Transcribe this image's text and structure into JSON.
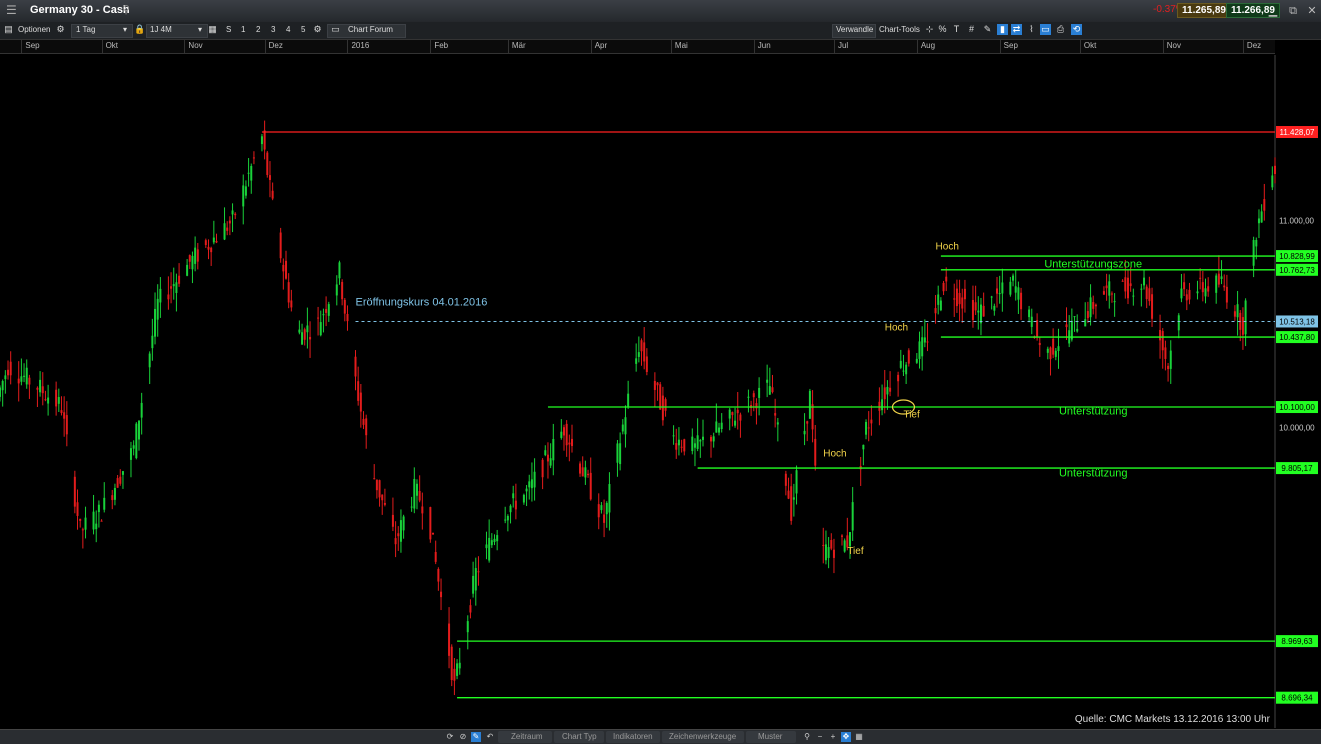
{
  "window": {
    "title": "Germany 30 - Cash",
    "change": "-0.37%",
    "sell_price": "11.265,89",
    "buy_price": "11.266,89"
  },
  "toolbar": {
    "options_label": "Optionen",
    "interval": "1 Tag",
    "range": "1J 4M",
    "period_buttons": [
      "S",
      "1",
      "2",
      "3",
      "4",
      "5"
    ],
    "chart_forum": "Chart Forum",
    "convert": "Verwandle",
    "chart_tools": "Chart-Tools"
  },
  "time_axis": {
    "labels": [
      "Sep",
      "Okt",
      "Nov",
      "Dez",
      "2016",
      "Feb",
      "Mär",
      "Apr",
      "Mai",
      "Jun",
      "Jul",
      "Aug",
      "Sep",
      "Okt",
      "Nov",
      "Dez"
    ]
  },
  "bottom_bar": {
    "items": [
      "Zeitraum",
      "Chart Typ",
      "Indikatoren",
      "Zeichenwerkzeuge",
      "Muster"
    ]
  },
  "source_text": "Quelle: CMC Markets 13.12.2016 13:00 Uhr",
  "colors": {
    "up": "#19d23a",
    "down": "#e41c1c",
    "support": "#22ff22",
    "resistance": "#ff2020",
    "note": "#f2d44a",
    "open_price": "#7fc3e6"
  },
  "chart_data": {
    "type": "candlestick",
    "instrument": "Germany 30 - Cash",
    "x_range": [
      "2015-08-24",
      "2016-12-13"
    ],
    "ylim": [
      8550,
      11800
    ],
    "y_ticks": [
      {
        "value": 11428.07,
        "label": "11.428,07",
        "kind": "resistance"
      },
      {
        "value": 11000,
        "label": "11.000,00",
        "kind": "tick"
      },
      {
        "value": 10828.99,
        "label": "10.828,99",
        "kind": "support"
      },
      {
        "value": 10762.73,
        "label": "10.762,73",
        "kind": "support"
      },
      {
        "value": 10513.18,
        "label": "10.513,18",
        "kind": "current"
      },
      {
        "value": 10437.8,
        "label": "10.437,80",
        "kind": "support"
      },
      {
        "value": 10100,
        "label": "10.100,00",
        "kind": "support"
      },
      {
        "value": 10000,
        "label": "10.000,00",
        "kind": "tick"
      },
      {
        "value": 9805.17,
        "label": "9.805,17",
        "kind": "support"
      },
      {
        "value": 8969.63,
        "label": "8.969,63",
        "kind": "support"
      },
      {
        "value": 8696.34,
        "label": "8.696,34",
        "kind": "support"
      }
    ],
    "lines": [
      {
        "value": 11428.07,
        "from": "2015-11-30",
        "color": "resistance"
      },
      {
        "value": 10828.99,
        "from": "2016-08-10",
        "color": "support"
      },
      {
        "value": 10762.73,
        "from": "2016-08-10",
        "color": "support"
      },
      {
        "value": 10513.18,
        "from": "2016-01-04",
        "color": "open_price",
        "dashed": true
      },
      {
        "value": 10437.8,
        "from": "2016-08-10",
        "color": "support"
      },
      {
        "value": 10100,
        "from": "2016-03-16",
        "color": "support"
      },
      {
        "value": 9805.17,
        "from": "2016-05-11",
        "color": "support"
      },
      {
        "value": 8969.63,
        "from": "2016-02-11",
        "color": "support"
      },
      {
        "value": 8696.34,
        "from": "2016-02-11",
        "color": "support"
      }
    ],
    "annotations": [
      {
        "text": "Eröffnungskurs 04.01.2016",
        "date": "2016-01-04",
        "value": 10590,
        "color": "open_price"
      },
      {
        "text": "Hoch",
        "date": "2016-08-08",
        "value": 10860,
        "color": "note"
      },
      {
        "text": "Hoch",
        "date": "2016-07-20",
        "value": 10470,
        "color": "note"
      },
      {
        "text": "Hoch",
        "date": "2016-06-27",
        "value": 9860,
        "color": "note"
      },
      {
        "text": "Tief",
        "date": "2016-07-06",
        "value": 9390,
        "color": "note"
      },
      {
        "text": "Tief",
        "date": "2016-07-27",
        "value": 10050,
        "color": "note"
      },
      {
        "text": "Unterstützungszone",
        "date": "2016-10-06",
        "value": 10775,
        "color": "support"
      },
      {
        "text": "Unterstützung",
        "date": "2016-10-06",
        "value": 10065,
        "color": "support"
      },
      {
        "text": "Unterstützung",
        "date": "2016-10-06",
        "value": 9765,
        "color": "support"
      }
    ],
    "price_anchors": [
      [
        "2015-08-24",
        10150
      ],
      [
        "2015-08-28",
        10300
      ],
      [
        "2015-09-08",
        10200
      ],
      [
        "2015-09-17",
        10100
      ],
      [
        "2015-09-24",
        9500
      ],
      [
        "2015-10-02",
        9600
      ],
      [
        "2015-10-14",
        9900
      ],
      [
        "2015-10-23",
        10600
      ],
      [
        "2015-11-04",
        10800
      ],
      [
        "2015-11-20",
        11000
      ],
      [
        "2015-12-01",
        11400
      ],
      [
        "2015-12-07",
        10900
      ],
      [
        "2015-12-14",
        10450
      ],
      [
        "2015-12-22",
        10500
      ],
      [
        "2015-12-30",
        10750
      ],
      [
        "2016-01-04",
        10300
      ],
      [
        "2016-01-11",
        9800
      ],
      [
        "2016-01-20",
        9450
      ],
      [
        "2016-01-27",
        9700
      ],
      [
        "2016-02-01",
        9600
      ],
      [
        "2016-02-11",
        8750
      ],
      [
        "2016-02-19",
        9300
      ],
      [
        "2016-03-01",
        9600
      ],
      [
        "2016-03-10",
        9700
      ],
      [
        "2016-03-23",
        10000
      ],
      [
        "2016-04-07",
        9550
      ],
      [
        "2016-04-20",
        10400
      ],
      [
        "2016-05-03",
        9950
      ],
      [
        "2016-05-11",
        9900
      ],
      [
        "2016-06-08",
        10200
      ],
      [
        "2016-06-16",
        9600
      ],
      [
        "2016-06-23",
        10150
      ],
      [
        "2016-06-27",
        9400
      ],
      [
        "2016-07-07",
        9450
      ],
      [
        "2016-07-14",
        10000
      ],
      [
        "2016-07-20",
        10150
      ],
      [
        "2016-07-27",
        10300
      ],
      [
        "2016-08-05",
        10400
      ],
      [
        "2016-08-12",
        10700
      ],
      [
        "2016-08-25",
        10550
      ],
      [
        "2016-09-07",
        10700
      ],
      [
        "2016-09-19",
        10350
      ],
      [
        "2016-09-30",
        10500
      ],
      [
        "2016-10-11",
        10650
      ],
      [
        "2016-10-26",
        10700
      ],
      [
        "2016-11-04",
        10300
      ],
      [
        "2016-11-09",
        10650
      ],
      [
        "2016-11-24",
        10700
      ],
      [
        "2016-12-02",
        10500
      ],
      [
        "2016-12-07",
        10950
      ],
      [
        "2016-12-13",
        11250
      ]
    ]
  }
}
